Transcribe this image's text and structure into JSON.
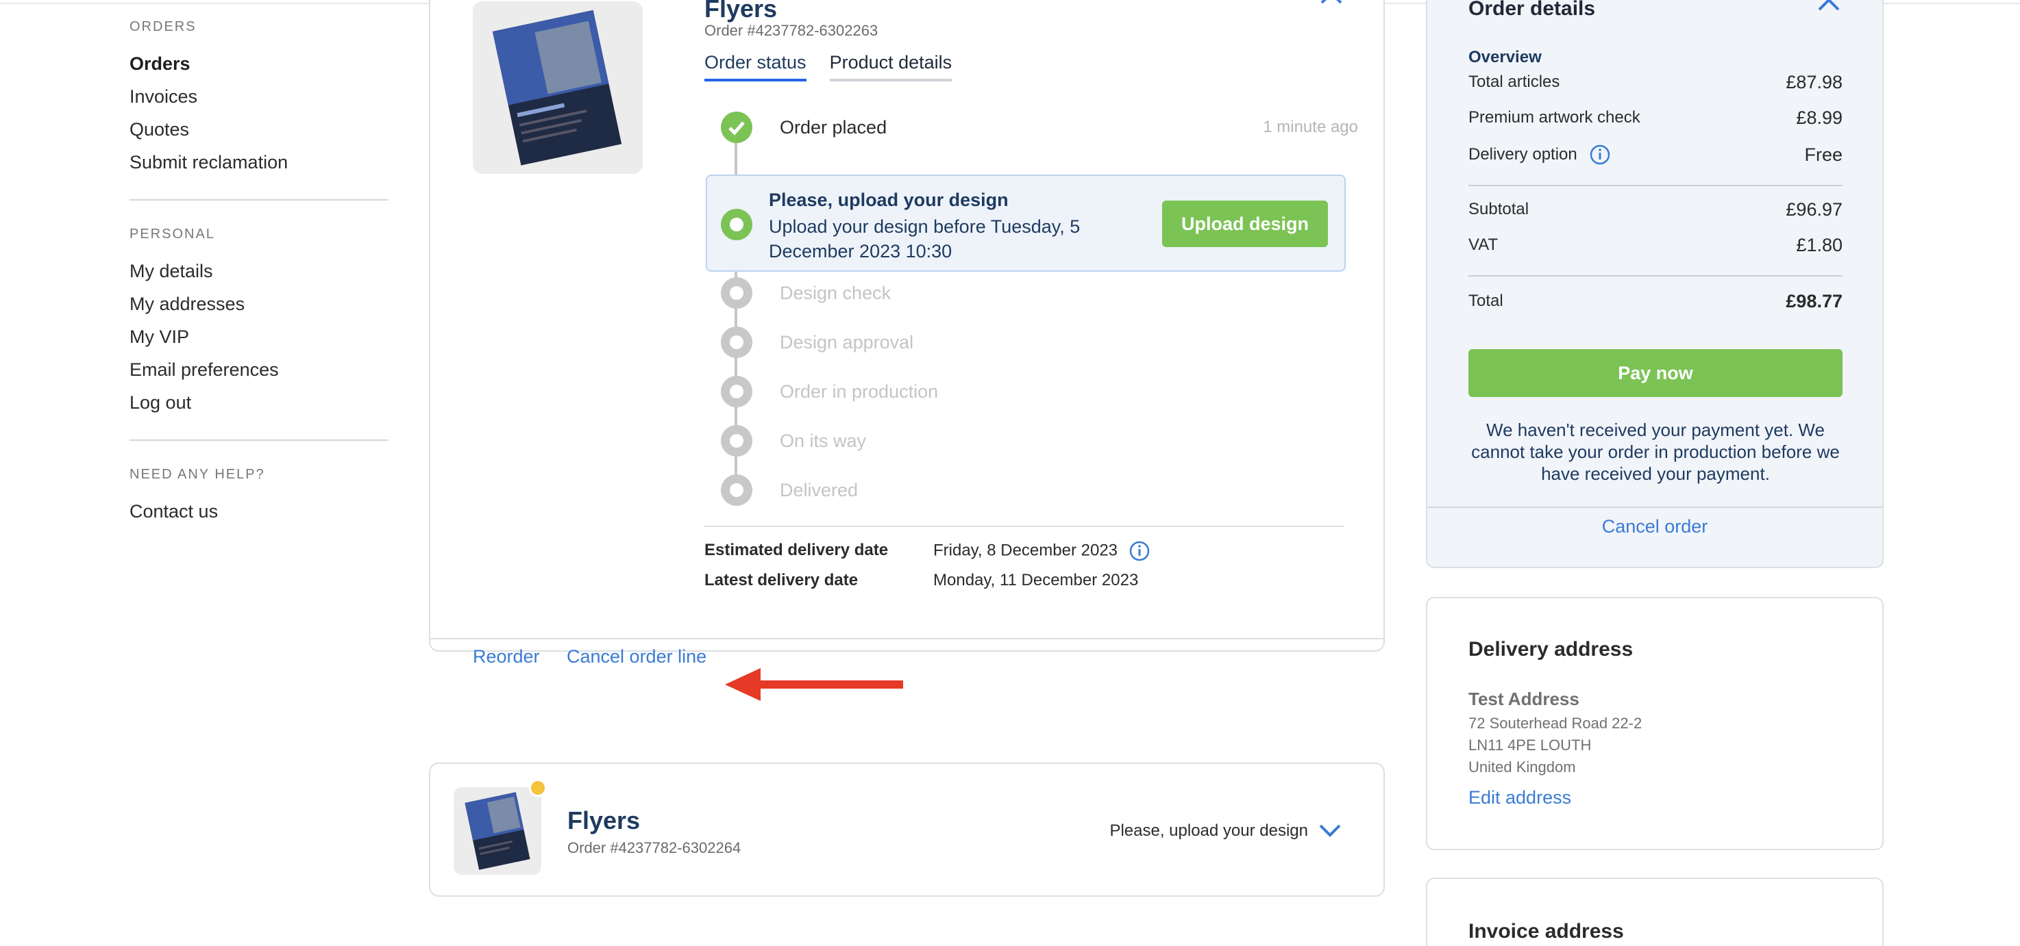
{
  "sidebar": {
    "orders_section": "ORDERS",
    "orders_items": [
      "Orders",
      "Invoices",
      "Quotes",
      "Submit reclamation"
    ],
    "personal_section": "PERSONAL",
    "personal_items": [
      "My details",
      "My addresses",
      "My VIP",
      "Email preferences",
      "Log out"
    ],
    "help_section": "NEED ANY HELP?",
    "help_items": [
      "Contact us"
    ]
  },
  "order_line": {
    "title": "Flyers",
    "order_number": "Order #4237782-6302263",
    "tabs": [
      "Order status",
      "Product details"
    ],
    "steps": {
      "placed": {
        "label": "Order placed",
        "time": "1 minute ago"
      },
      "current": {
        "title": "Please, upload your design",
        "text": "Upload your design before Tuesday, 5 December 2023 10:30",
        "button": "Upload design"
      },
      "design_check": "Design check",
      "design_approval": "Design approval",
      "production": "Order in production",
      "on_way": "On its way",
      "delivered": "Delivered"
    },
    "estimated_delivery_label": "Estimated delivery date",
    "estimated_delivery_value": "Friday, 8 December 2023",
    "latest_delivery_label": "Latest delivery date",
    "latest_delivery_value": "Monday, 11 December 2023",
    "reorder": "Reorder",
    "cancel_line": "Cancel order line"
  },
  "second_line": {
    "title": "Flyers",
    "order_number": "Order #4237782-6302264",
    "status": "Please, upload your design"
  },
  "order_details": {
    "title": "Order details",
    "overview": "Overview",
    "total_articles_label": "Total articles",
    "total_articles_value": "£87.98",
    "artwork_label": "Premium artwork check",
    "artwork_value": "£8.99",
    "delivery_label": "Delivery option",
    "delivery_value": "Free",
    "subtotal_label": "Subtotal",
    "subtotal_value": "£96.97",
    "vat_label": "VAT",
    "vat_value": "£1.80",
    "total_label": "Total",
    "total_value": "£98.77",
    "pay_button": "Pay now",
    "payment_note": "We haven't received your payment yet. We cannot take your order in production before we have received your payment.",
    "cancel_order": "Cancel order"
  },
  "delivery_address": {
    "title": "Delivery address",
    "name": "Test Address",
    "line1": "72 Souterhead Road 22-2",
    "line2": "LN11 4PE LOUTH",
    "line3": "United Kingdom",
    "edit": "Edit address"
  },
  "invoice_address": {
    "title": "Invoice address"
  },
  "colors": {
    "accent_blue": "#3a7bd5",
    "navy": "#1e3a5f",
    "green": "#7bc355",
    "badge_yellow": "#f4c23b",
    "arrow_red": "#e43a26"
  }
}
